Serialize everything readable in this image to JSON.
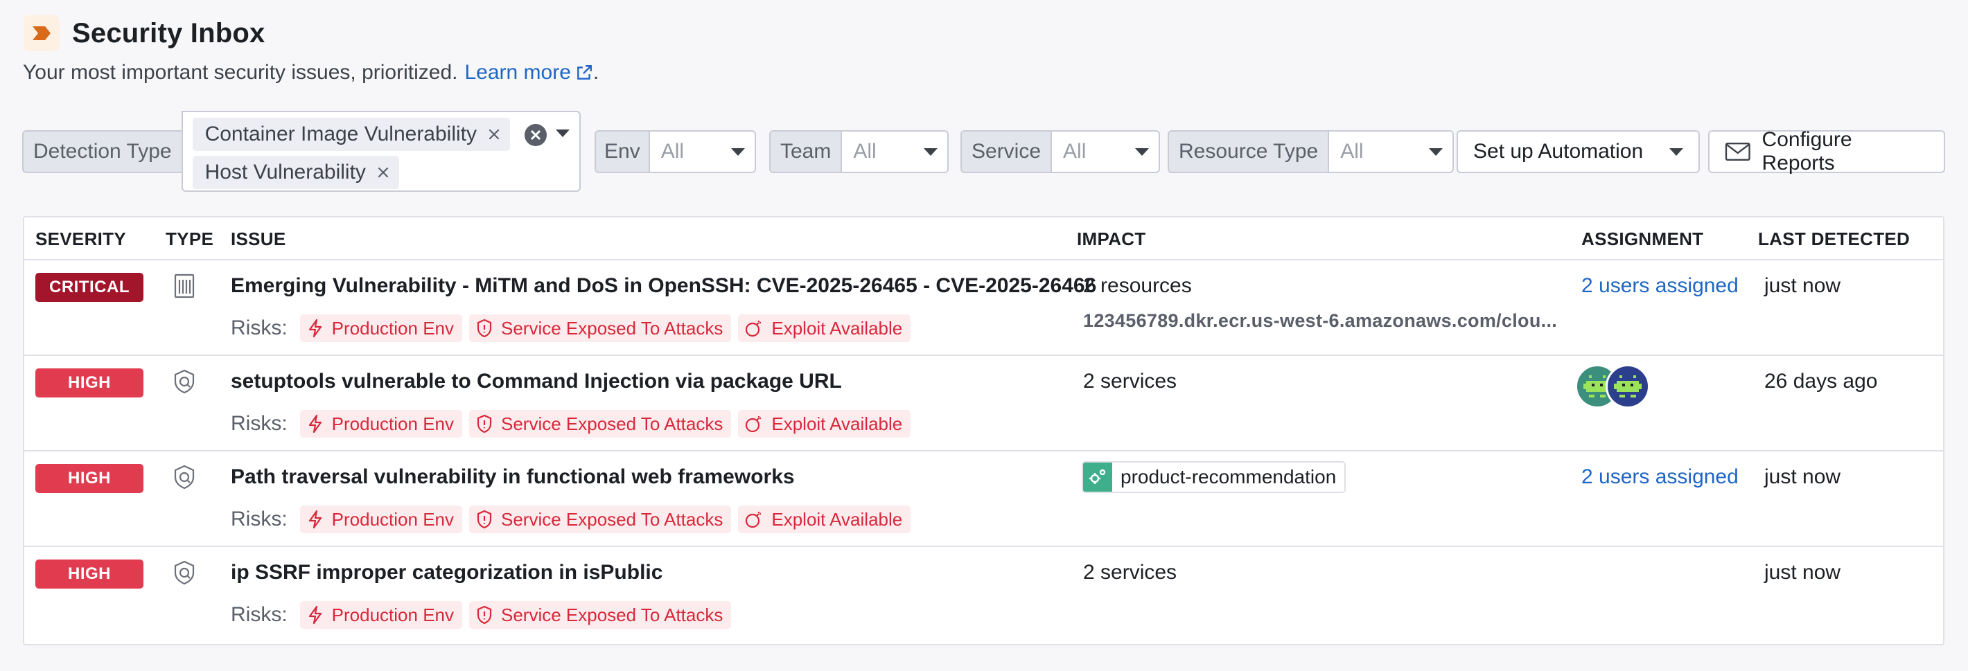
{
  "header": {
    "title": "Security Inbox",
    "subtitle": "Your most important security issues, prioritized.",
    "learn_more": "Learn more",
    "period": "."
  },
  "filters": {
    "detection_type": {
      "label": "Detection Type",
      "chips": [
        "Container Image Vulnerability",
        "Host Vulnerability"
      ]
    },
    "env": {
      "label": "Env",
      "value": "All"
    },
    "team": {
      "label": "Team",
      "value": "All"
    },
    "service": {
      "label": "Service",
      "value": "All"
    },
    "resource_type": {
      "label": "Resource Type",
      "value": "All"
    }
  },
  "actions": {
    "automation": "Set up Automation",
    "reports": "Configure Reports"
  },
  "table": {
    "columns": [
      "SEVERITY",
      "TYPE",
      "ISSUE",
      "IMPACT",
      "ASSIGNMENT",
      "LAST DETECTED"
    ],
    "risks_label": "Risks:",
    "rows": [
      {
        "severity": "CRITICAL",
        "type_icon": "building-icon",
        "issue": "Emerging Vulnerability - MiTM and DoS in OpenSSH: CVE-2025-26465 - CVE-2025-26466",
        "risks": [
          "Production Env",
          "Service Exposed To Attacks",
          "Exploit Available"
        ],
        "impact": "2 resources",
        "impact_sub": "123456789.dkr.ecr.us-west-6.amazonaws.com/clou...",
        "assignment": "2 users assigned",
        "last_detected": "just now"
      },
      {
        "severity": "HIGH",
        "type_icon": "shield-scan-icon",
        "issue": "setuptools vulnerable to Command Injection via package URL",
        "risks": [
          "Production Env",
          "Service Exposed To Attacks",
          "Exploit Available"
        ],
        "impact": "2 services",
        "assignment": "",
        "last_detected": "26 days ago"
      },
      {
        "severity": "HIGH",
        "type_icon": "shield-scan-icon",
        "issue": "Path traversal vulnerability in functional web frameworks",
        "risks": [
          "Production Env",
          "Service Exposed To Attacks",
          "Exploit Available"
        ],
        "impact_service": "product-recommendation",
        "assignment": "2 users assigned",
        "last_detected": "just now"
      },
      {
        "severity": "HIGH",
        "type_icon": "shield-scan-icon",
        "issue": "ip SSRF improper categorization in isPublic",
        "risks": [
          "Production Env",
          "Service Exposed To Attacks"
        ],
        "impact": "2 services",
        "assignment": "",
        "last_detected": "just now"
      }
    ]
  },
  "colors": {
    "critical": "#a3152a",
    "high": "#e03b4f",
    "link": "#1f66c4",
    "risk_text": "#d8283a",
    "risk_bg": "#fdecee",
    "logo_accent": "#d86a1a"
  }
}
